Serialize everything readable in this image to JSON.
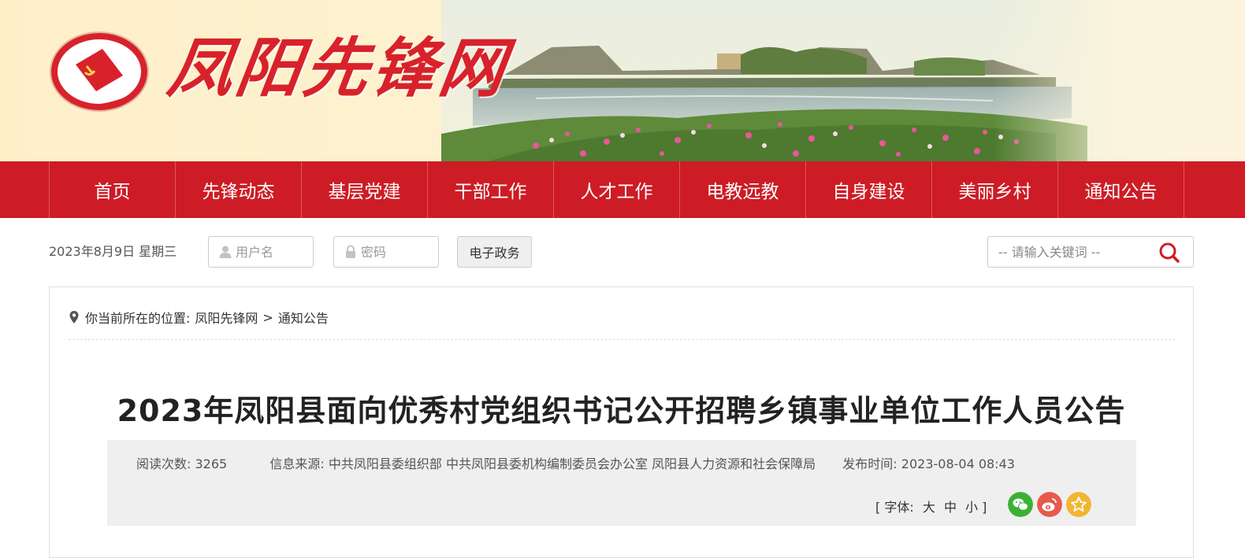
{
  "site": {
    "name": "凤阳先锋网"
  },
  "nav": {
    "items": [
      "首页",
      "先锋动态",
      "基层党建",
      "干部工作",
      "人才工作",
      "电教远教",
      "自身建设",
      "美丽乡村",
      "通知公告"
    ]
  },
  "toolbar": {
    "date": "2023年8月9日 星期三",
    "username_placeholder": "用户名",
    "password_placeholder": "密码",
    "egov_label": "电子政务",
    "search_placeholder": "-- 请输入关键词 --"
  },
  "breadcrumb": {
    "prefix": "你当前所在的位置:",
    "home": "凤阳先锋网",
    "separator": ">",
    "current": "通知公告"
  },
  "article": {
    "title": "2023年凤阳县面向优秀村党组织书记公开招聘乡镇事业单位工作人员公告",
    "views_label": "阅读次数:",
    "views_value": "3265",
    "source_label": "信息来源:",
    "source_value": "中共凤阳县委组织部 中共凤阳县委机构编制委员会办公室 凤阳县人力资源和社会保障局",
    "time_label": "发布时间:",
    "time_value": "2023-08-04 08:43",
    "font_label": "[ 字体:",
    "font_large": "大",
    "font_medium": "中",
    "font_small": "小 ]"
  },
  "colors": {
    "brand_red": "#cd1c25",
    "wechat_green": "#3cb035",
    "weibo_red": "#e65a4e",
    "favorite_yellow": "#f2b531"
  }
}
